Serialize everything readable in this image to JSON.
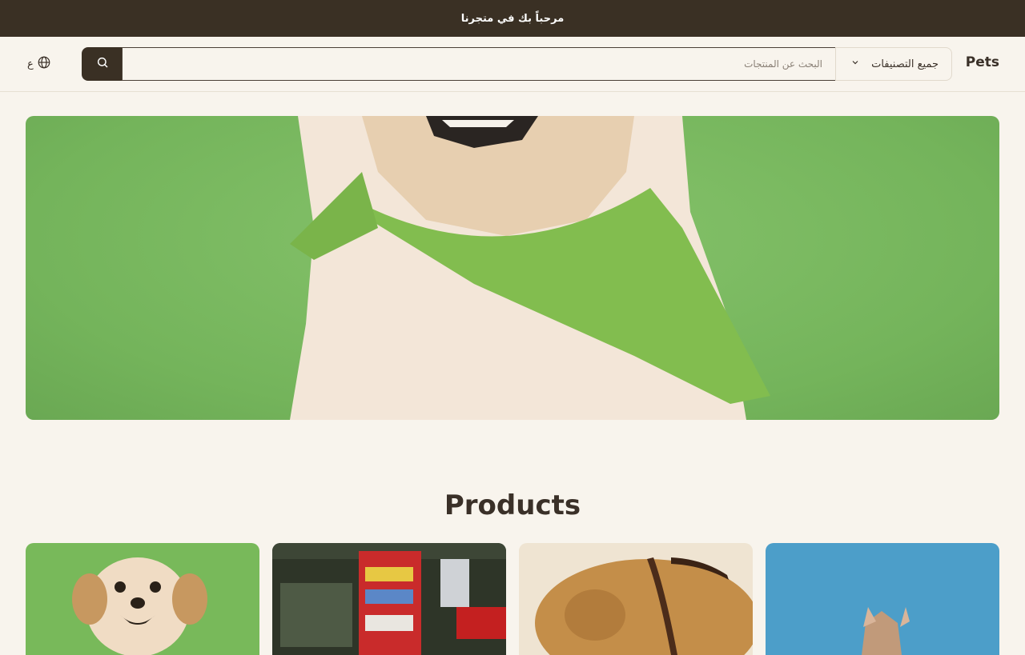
{
  "announcement": {
    "text": "مرحباً بك في متجرنا"
  },
  "header": {
    "brand": "Pets",
    "category_select": {
      "selected": "جميع التصنيفات"
    },
    "search": {
      "placeholder": "البحث عن المنتجات",
      "value": ""
    },
    "language_label": "ع"
  },
  "products": {
    "title": "Products",
    "items": [
      {
        "image": "dog-with-green-bandana"
      },
      {
        "image": "pet-store-shelves"
      },
      {
        "image": "brown-dog-with-leash"
      },
      {
        "image": "french-bulldog-on-blue"
      }
    ]
  },
  "colors": {
    "topbar": "#3a3024",
    "background": "#f8f4ed",
    "hero_green": "#7ab862",
    "search_button": "#3a3024"
  },
  "icons": {
    "search": "search-icon",
    "globe": "globe-icon",
    "chevron": "chevron-down-icon"
  }
}
